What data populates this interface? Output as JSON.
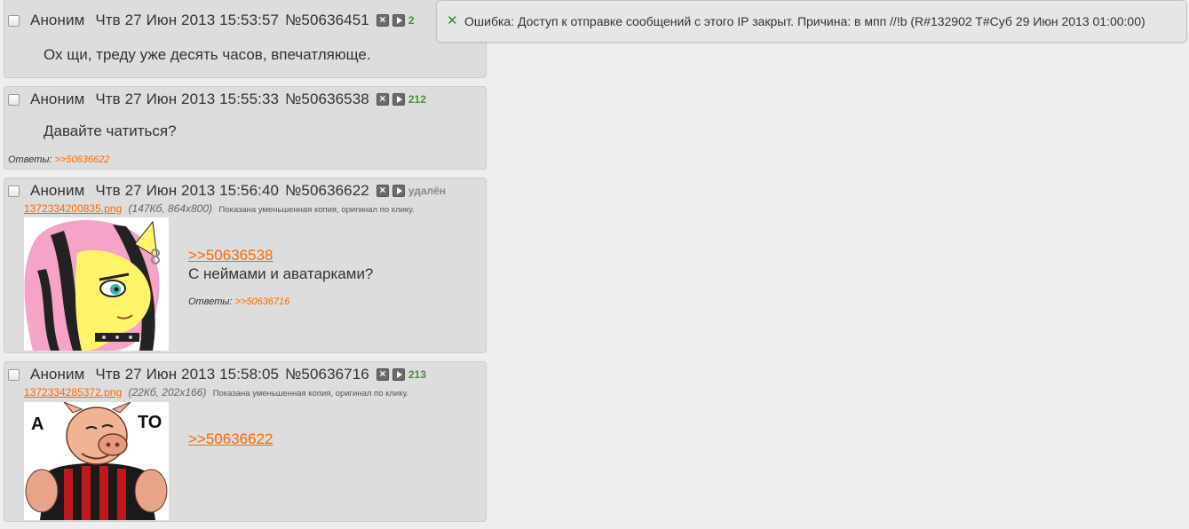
{
  "error": {
    "icon": "close-icon",
    "text": "Ошибка: Доступ к отправке сообщений с этого IP закрыт. Причина: в мпп //!b (R#132902 T#Суб 29 Июн 2013 01:00:00)"
  },
  "posts": [
    {
      "name": "Аноним",
      "date": "Чтв 27 Июн 2013 15:53:57",
      "num": "№50636451",
      "badge": "2",
      "message": "Ох щи, треду уже десять часов, впечатляюще."
    },
    {
      "name": "Аноним",
      "date": "Чтв 27 Июн 2013 15:55:33",
      "num": "№50636538",
      "badge": "212",
      "message": "Давайте чатиться?",
      "replies_label": "Ответы:",
      "replies": ">>50636622"
    },
    {
      "name": "Аноним",
      "date": "Чтв 27 Июн 2013 15:56:40",
      "num": "№50636622",
      "badge": "удалён",
      "file": {
        "name": "1372334200835.png",
        "meta": "(147Кб, 864x800)",
        "note": "Показана уменьшенная копия, оригинал по клику."
      },
      "quote_link": ">>50636538",
      "message": "С неймами и аватарками?",
      "replies_label": "Ответы:",
      "replies": ">>50636716"
    },
    {
      "name": "Аноним",
      "date": "Чтв 27 Июн 2013 15:58:05",
      "num": "№50636716",
      "badge": "213",
      "file": {
        "name": "1372334285372.png",
        "meta": "(22Кб, 202x166)",
        "note": "Показана уменьшенная копия, оригинал по клику."
      },
      "quote_link": ">>50636622",
      "image_text_left": "А",
      "image_text_right": "ТО"
    }
  ],
  "colors": {
    "accent_link": "#ff6600",
    "reply_count": "#4a8f3a",
    "post_bg": "#dddddd",
    "page_bg": "#eeeeee"
  }
}
